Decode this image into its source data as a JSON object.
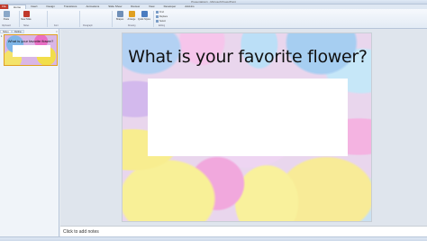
{
  "window": {
    "title": "Presentation1 - Microsoft PowerPoint"
  },
  "ribbon": {
    "file_tab": "File",
    "tabs": [
      "Home",
      "Insert",
      "Design",
      "Transitions",
      "Animations",
      "Slide Show",
      "Review",
      "View",
      "Developer",
      "Add-Ins"
    ],
    "active_tab": "Home",
    "buttons": [
      {
        "label": "Paste",
        "icon": "paste-icon",
        "color": "#8aa8c8"
      },
      {
        "label": "New Slide",
        "icon": "new-slide-icon",
        "color": "#c0392b"
      },
      {
        "label": "Shapes",
        "icon": "shapes-icon",
        "color": "#6f8fb8"
      },
      {
        "label": "Arrange",
        "icon": "arrange-icon",
        "color": "#e0a020"
      },
      {
        "label": "Quick Styles",
        "icon": "quick-styles-icon",
        "color": "#4a7cc0"
      }
    ],
    "small_items": [
      "Find",
      "Replace",
      "Select"
    ],
    "groups": [
      "Clipboard",
      "Slides",
      "Font",
      "Paragraph",
      "Drawing",
      "Editing"
    ]
  },
  "left_panel": {
    "tabs": [
      "Slides",
      "Outline"
    ],
    "active_tab": "Slides",
    "close_glyph": "×",
    "slides": [
      {
        "number": "1",
        "title": "What is your favorite flower?"
      }
    ]
  },
  "slide": {
    "title": "What is your favorite flower?"
  },
  "notes": {
    "placeholder": "Click to add notes"
  },
  "colors": {
    "accent": "#e0a020",
    "file_tab": "#c0392b"
  }
}
